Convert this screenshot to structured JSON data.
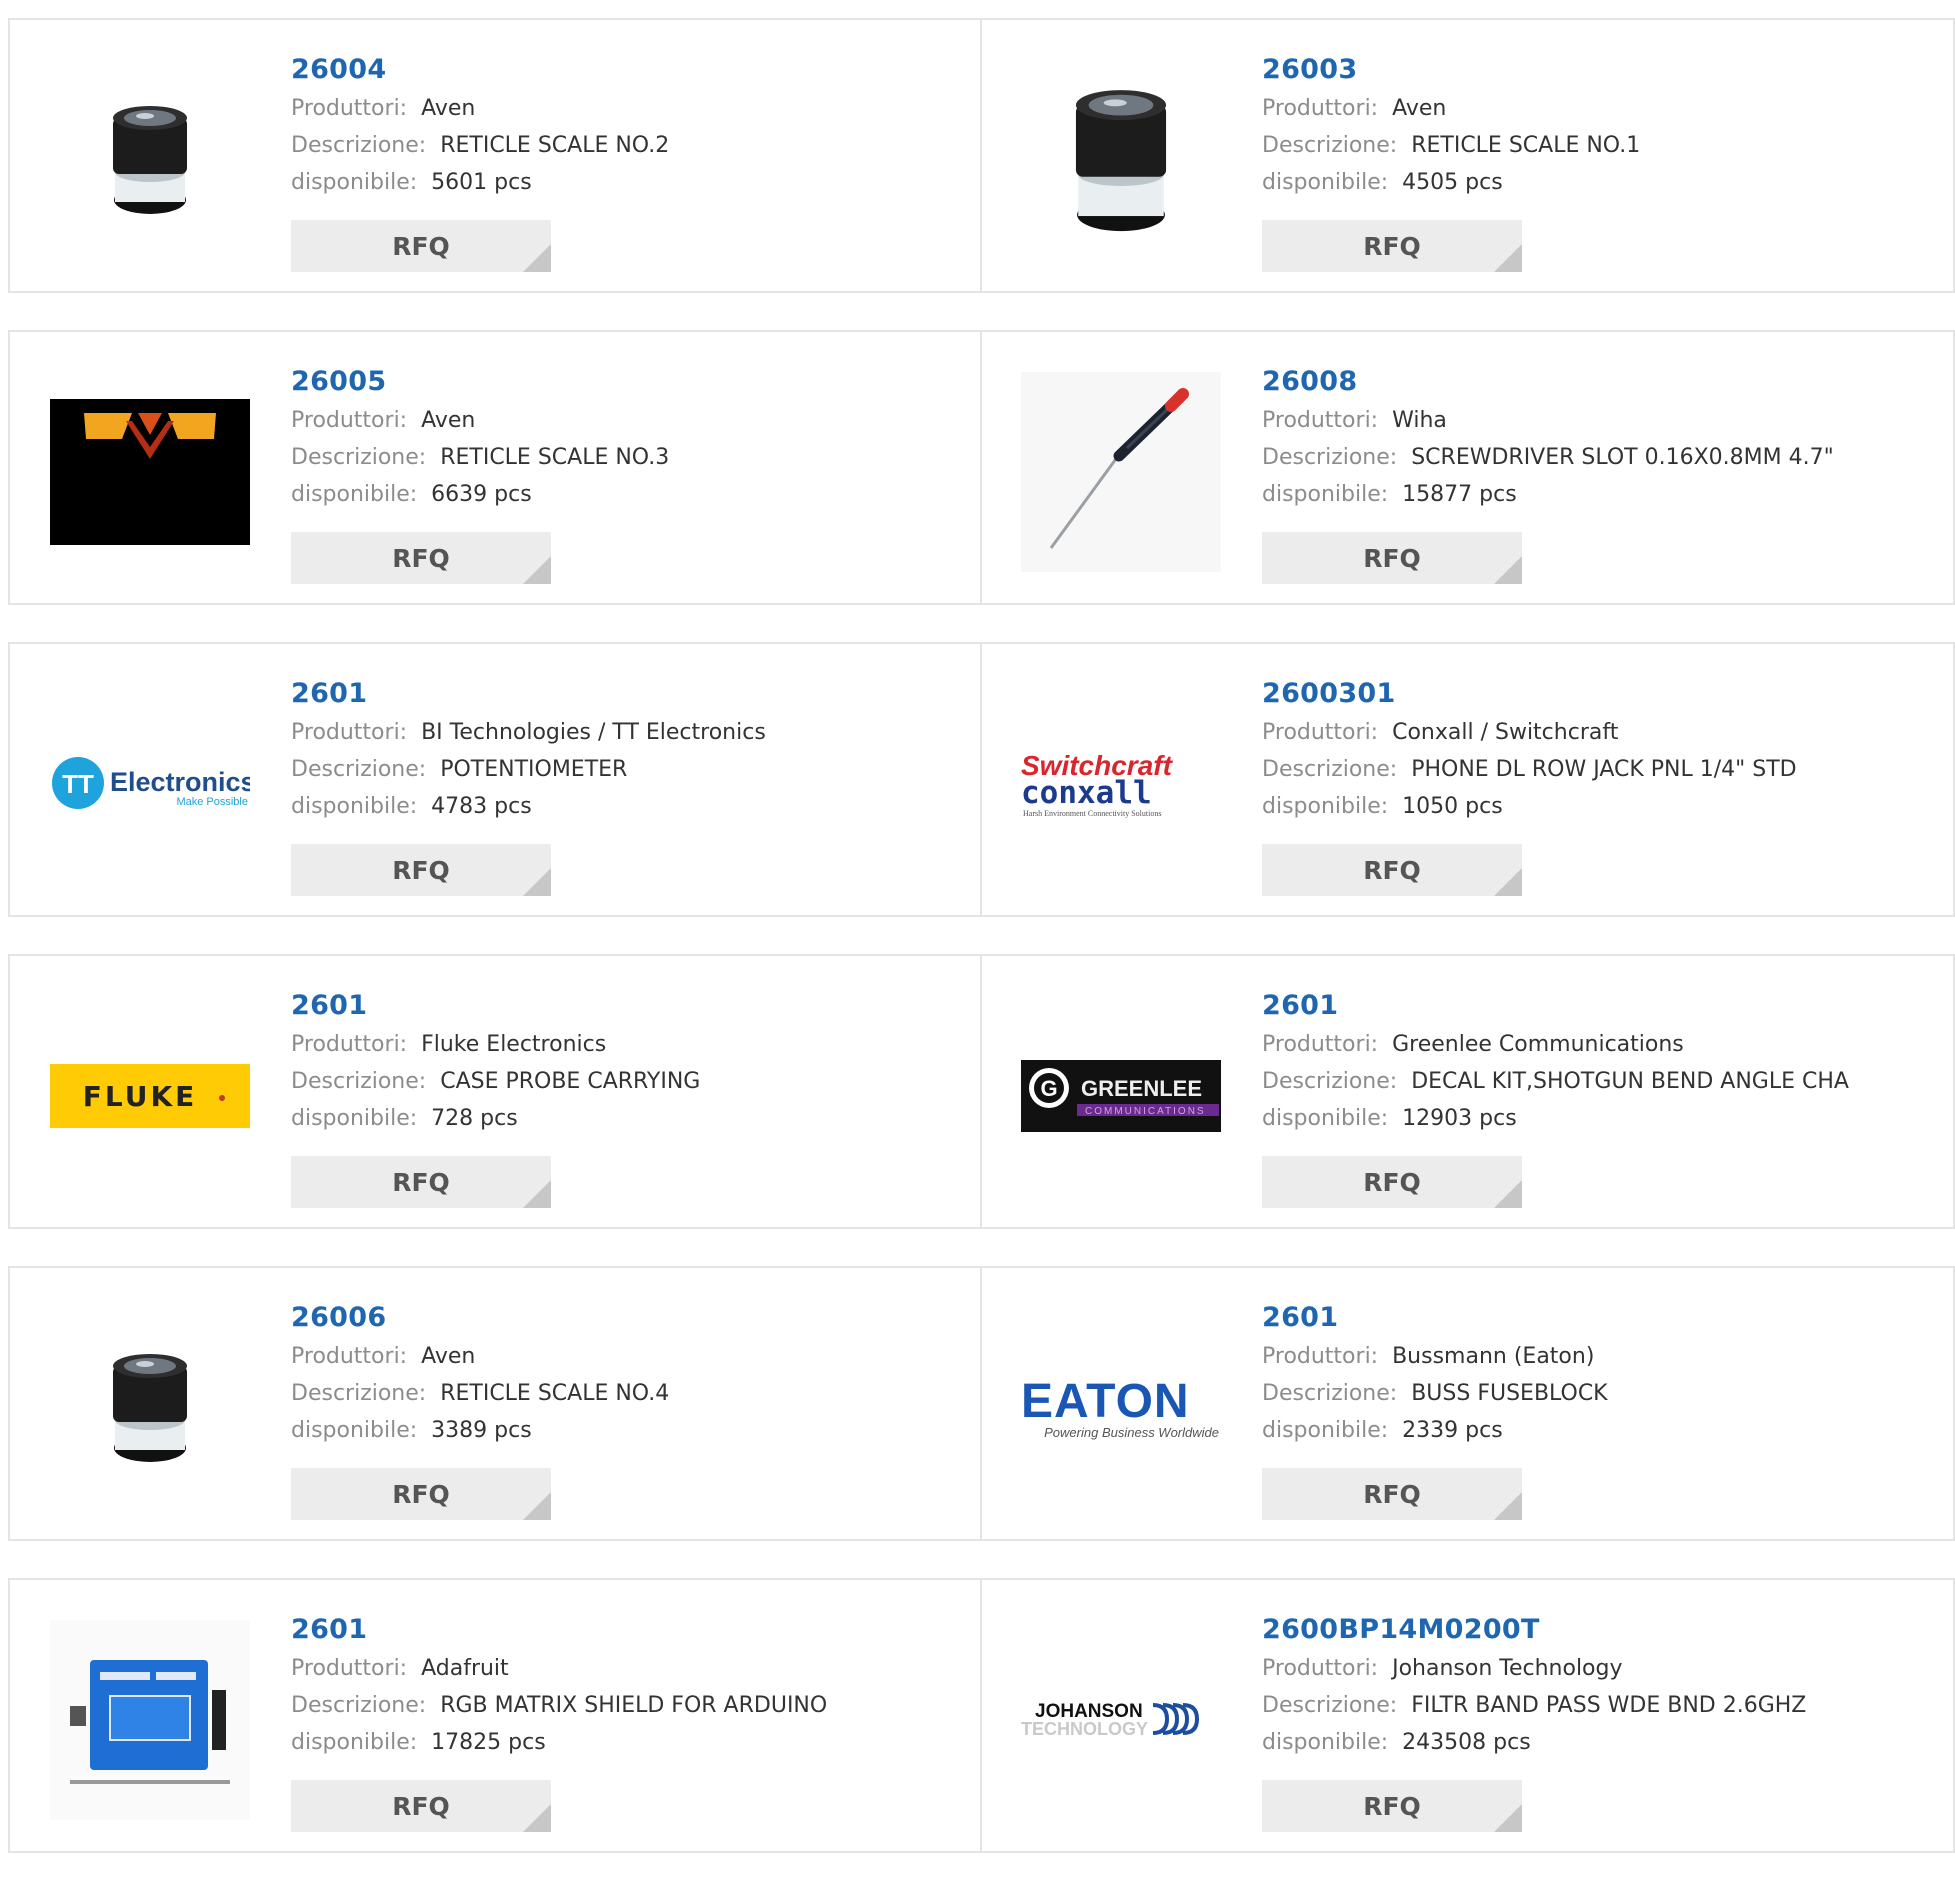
{
  "labels": {
    "manufacturer": "Produttori:",
    "description": "Descrizione:",
    "available": "disponibile:",
    "rfq": "RFQ"
  },
  "products": [
    {
      "part": "26004",
      "manufacturer": "Aven",
      "description": "RETICLE SCALE NO.2",
      "stock": "5601 pcs",
      "image": "loupe-icon"
    },
    {
      "part": "26003",
      "manufacturer": "Aven",
      "description": "RETICLE SCALE NO.1",
      "stock": "4505 pcs",
      "image": "loupe-icon"
    },
    {
      "part": "26005",
      "manufacturer": "Aven",
      "description": "RETICLE SCALE NO.3",
      "stock": "6639 pcs",
      "image": "aven-logo"
    },
    {
      "part": "26008",
      "manufacturer": "Wiha",
      "description": "SCREWDRIVER SLOT 0.16X0.8MM 4.7\"",
      "stock": "15877 pcs",
      "image": "screwdriver-icon"
    },
    {
      "part": "2601",
      "manufacturer": "BI Technologies / TT Electronics",
      "description": "POTENTIOMETER",
      "stock": "4783 pcs",
      "image": "tt-electronics-logo",
      "logo_text": "Electronics",
      "logo_sub": "Make Possible"
    },
    {
      "part": "2600301",
      "manufacturer": "Conxall / Switchcraft",
      "description": "PHONE DL ROW JACK PNL 1/4\" STD",
      "stock": "1050 pcs",
      "image": "switchcraft-conxall-logo",
      "logo_text": "Switchcraft",
      "logo_text2": "conxall",
      "logo_sub": "Harsh Environment Connectivity Solutions"
    },
    {
      "part": "2601",
      "manufacturer": "Fluke Electronics",
      "description": "CASE PROBE CARRYING",
      "stock": "728 pcs",
      "image": "fluke-logo",
      "logo_text": "FLUKE"
    },
    {
      "part": "2601",
      "manufacturer": "Greenlee Communications",
      "description": "DECAL KIT,SHOTGUN BEND ANGLE CHA",
      "stock": "12903 pcs",
      "image": "greenlee-logo",
      "logo_text": "GREENLEE",
      "logo_sub": "COMMUNICATIONS"
    },
    {
      "part": "26006",
      "manufacturer": "Aven",
      "description": "RETICLE SCALE NO.4",
      "stock": "3389 pcs",
      "image": "loupe-icon"
    },
    {
      "part": "2601",
      "manufacturer": "Bussmann (Eaton)",
      "description": "BUSS FUSEBLOCK",
      "stock": "2339 pcs",
      "image": "eaton-logo",
      "logo_text": "EATON",
      "logo_sub": "Powering Business Worldwide"
    },
    {
      "part": "2601",
      "manufacturer": "Adafruit",
      "description": "RGB MATRIX SHIELD FOR ARDUINO",
      "stock": "17825 pcs",
      "image": "circuit-board-icon"
    },
    {
      "part": "2600BP14M0200T",
      "manufacturer": "Johanson Technology",
      "description": "FILTR BAND PASS WDE BND 2.6GHZ",
      "stock": "243508 pcs",
      "image": "johanson-logo",
      "logo_text": "JOHANSON",
      "logo_sub": "TECHNOLOGY"
    }
  ]
}
